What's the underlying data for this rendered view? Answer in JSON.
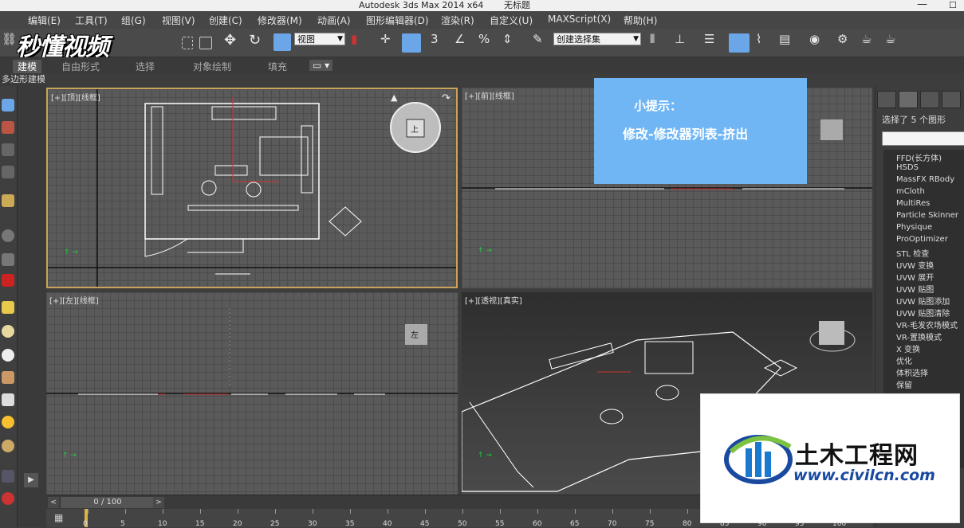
{
  "window": {
    "title": "Autodesk 3ds Max  2014 x64",
    "doc_title": "无标题"
  },
  "menu": [
    "编辑(E)",
    "工具(T)",
    "组(G)",
    "视图(V)",
    "创建(C)",
    "修改器(M)",
    "动画(A)",
    "图形编辑器(D)",
    "渲染(R)",
    "自定义(U)",
    "MAXScript(X)",
    "帮助(H)"
  ],
  "toolbar": {
    "view_dropdown": "视图",
    "selection_set_dropdown": "创建选择集",
    "snap_label": "3",
    "watermark_logo": "秒懂视频"
  },
  "ribbon": {
    "tabs": [
      "建模",
      "自由形式",
      "选择",
      "对象绘制",
      "填充"
    ],
    "sub_label": "多边形建模"
  },
  "viewports": {
    "top": "[+][顶][线框]",
    "front": "[+][前][线框]",
    "left": "[+][左][线框]",
    "persp": "[+][透视][真实]",
    "viewcube_top": "上",
    "viewcube_left": "左"
  },
  "tip": {
    "title": "小提示：",
    "body": "修改-修改器列表-挤出"
  },
  "command_panel": {
    "selected": "选择了 5 个图形",
    "modifiers": [
      "FFD(长方体)",
      "HSDS",
      "MassFX RBody",
      "mCloth",
      "MultiRes",
      "Particle Skinner",
      "Physique",
      "ProOptimizer",
      "STL 检查",
      "UVW 变换",
      "UVW 展开",
      "UVW 贴图",
      "UVW 贴图添加",
      "UVW 贴图清除",
      "VR-毛发农场模式",
      "VR-置换模式",
      "X 变换",
      "优化",
      "体积选择",
      "保留"
    ]
  },
  "timeline": {
    "frame": "0 / 100",
    "ticks": [
      "0",
      "5",
      "10",
      "15",
      "20",
      "25",
      "30",
      "35",
      "40",
      "45",
      "50",
      "55",
      "60",
      "65",
      "70",
      "75",
      "80",
      "85",
      "90",
      "95",
      "100"
    ]
  },
  "civil_watermark": {
    "name": "土木工程网",
    "url": "www.civilcn.com"
  }
}
